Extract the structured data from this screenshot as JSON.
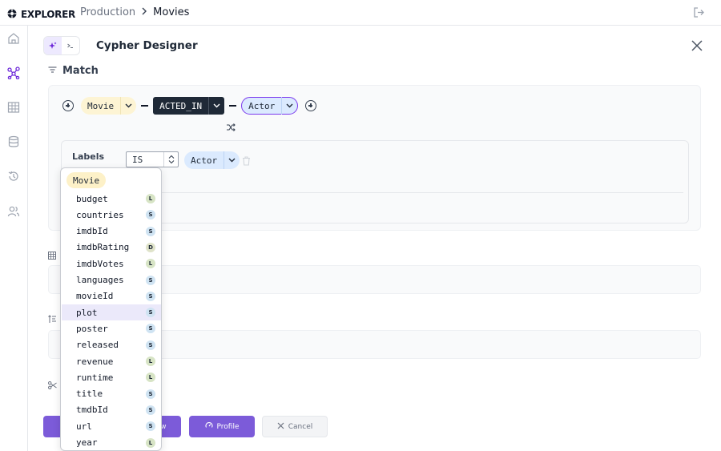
{
  "app": {
    "name": "EXPLORER"
  },
  "breadcrumb": {
    "root": "Production",
    "current": "Movies"
  },
  "panel": {
    "title": "Cypher Designer",
    "mode_icons": [
      "ai-sparkle-icon",
      "terminal-icon"
    ]
  },
  "match": {
    "title": "Match",
    "pattern": {
      "start_node": "Movie",
      "relationship": "ACTED_IN",
      "end_node": "Actor"
    },
    "filter": {
      "label": "Labels",
      "operator": "IS",
      "value": "Actor"
    }
  },
  "buttons": {
    "preview": "Preview",
    "profile": "Profile",
    "cancel": "Cancel"
  },
  "dropdown": {
    "header": "Movie",
    "items": [
      {
        "label": "budget",
        "type": "L"
      },
      {
        "label": "countries",
        "type": "S"
      },
      {
        "label": "imdbId",
        "type": "S"
      },
      {
        "label": "imdbRating",
        "type": "D"
      },
      {
        "label": "imdbVotes",
        "type": "L"
      },
      {
        "label": "languages",
        "type": "S"
      },
      {
        "label": "movieId",
        "type": "S"
      },
      {
        "label": "plot",
        "type": "S"
      },
      {
        "label": "poster",
        "type": "S"
      },
      {
        "label": "released",
        "type": "S"
      },
      {
        "label": "revenue",
        "type": "L"
      },
      {
        "label": "runtime",
        "type": "L"
      },
      {
        "label": "title",
        "type": "S"
      },
      {
        "label": "tmdbId",
        "type": "S"
      },
      {
        "label": "url",
        "type": "S"
      },
      {
        "label": "year",
        "type": "L"
      }
    ],
    "highlighted": "plot"
  },
  "colors": {
    "accent": "#7c5bd9",
    "node_movie": "#fdf4d4",
    "node_actor": "#dbeafe",
    "badge_L": "#d7e4c5",
    "badge_S": "#cfe3f2",
    "badge_D": "#dfe3c9"
  }
}
